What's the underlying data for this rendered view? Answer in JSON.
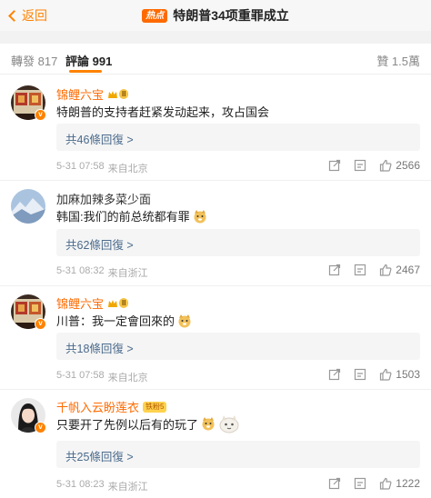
{
  "header": {
    "back_label": "返回",
    "hot_badge": "热点",
    "title": "特朗普34项重罪成立"
  },
  "tabs": {
    "repost": "轉發 817",
    "comments": "評論 991",
    "likes": "贊 1.5萬"
  },
  "accent_color": "#ff8200",
  "comments": [
    {
      "username": "锦鲤六宝",
      "level": "II",
      "text": "特朗普的支持者赶紧发动起来，攻占国会",
      "replies": "共46條回復 >",
      "time": "5-31 07:58",
      "location": "来自北京",
      "likes": "2566"
    },
    {
      "username": "加麻加辣多菜少面",
      "text": "韩国:我们的前总统都有罪",
      "replies": "共62條回復 >",
      "time": "5-31 08:32",
      "location": "来自浙江",
      "likes": "2467"
    },
    {
      "username": "锦鲤六宝",
      "level": "II",
      "text": "川普：我一定會回來的",
      "replies": "共18條回復 >",
      "time": "5-31 07:58",
      "location": "来自北京",
      "likes": "1503"
    },
    {
      "username": "千帆入云盼莲衣",
      "fan_badge": "铁粉5",
      "text": "只要开了先例以后有的玩了",
      "replies": "共25條回復 >",
      "time": "5-31 08:23",
      "location": "来自浙江",
      "likes": "1222"
    }
  ]
}
